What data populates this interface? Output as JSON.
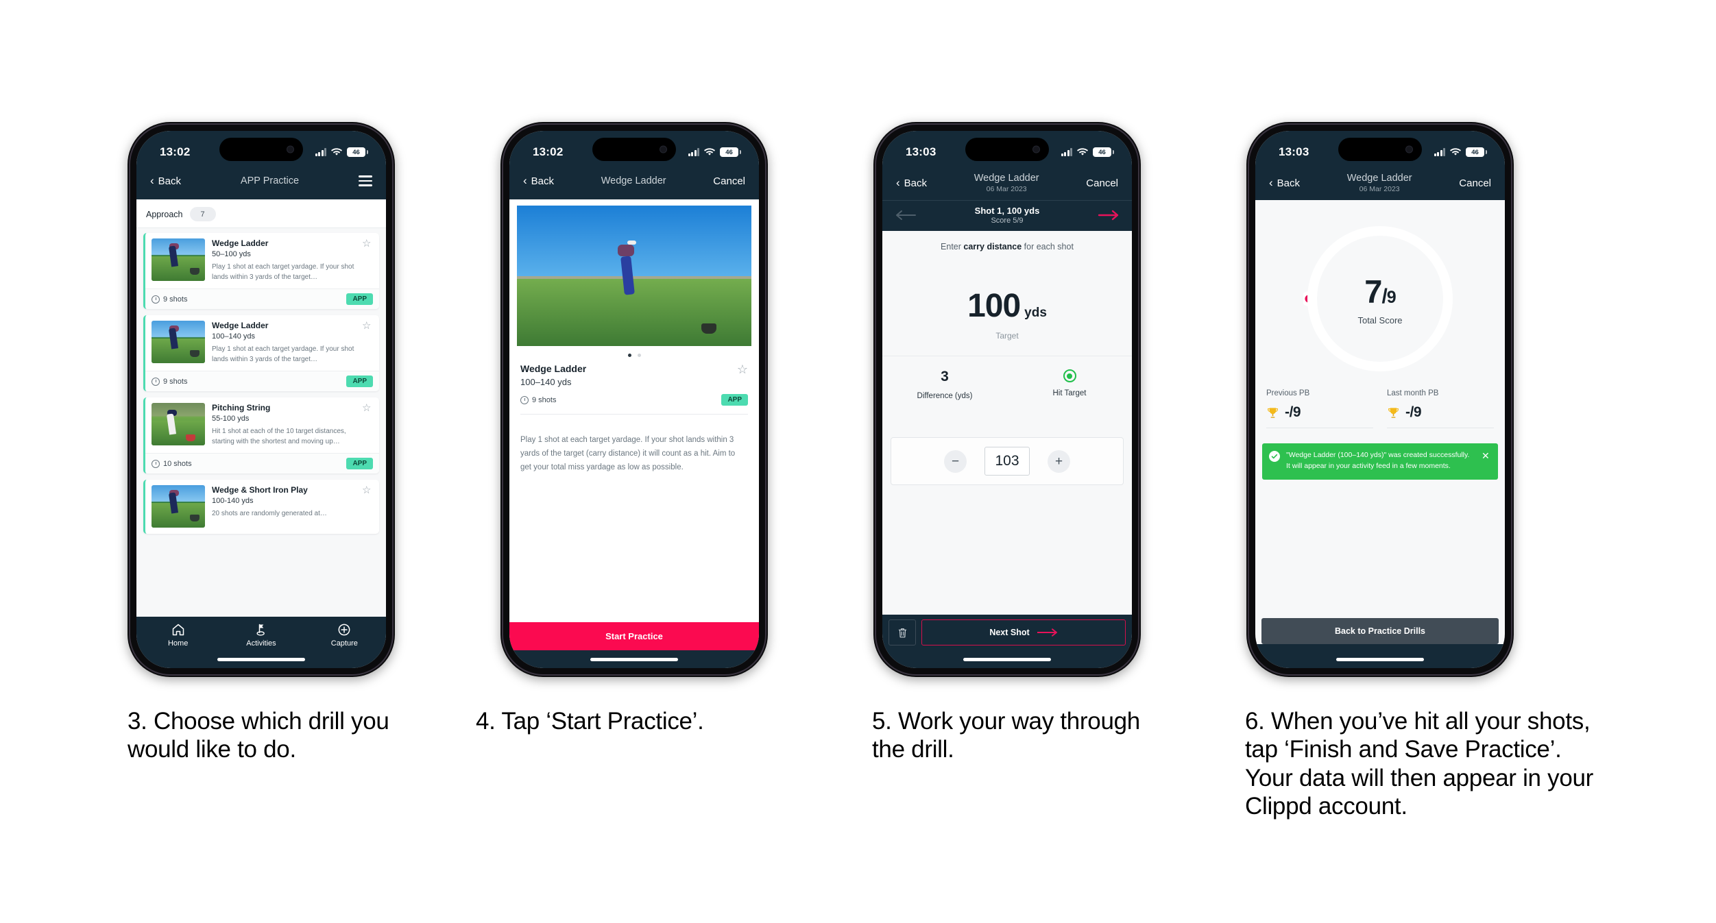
{
  "screens": [
    {
      "status": {
        "time": "13:02",
        "battery": "46"
      },
      "nav": {
        "back": "Back",
        "title": "APP Practice",
        "menu_icon": "hamburger-icon"
      },
      "section": {
        "name": "Approach",
        "count": "7"
      },
      "cards": [
        {
          "title": "Wedge Ladder",
          "yards": "50–100 yds",
          "desc": "Play 1 shot at each target yardage. If your shot lands within 3 yards of the target…",
          "shots": "9 shots",
          "badge": "APP"
        },
        {
          "title": "Wedge Ladder",
          "yards": "100–140 yds",
          "desc": "Play 1 shot at each target yardage. If your shot lands within 3 yards of the target…",
          "shots": "9 shots",
          "badge": "APP"
        },
        {
          "title": "Pitching String",
          "yards": "55-100 yds",
          "desc": "Hit 1 shot at each of the 10 target distances, starting with the shortest and moving up…",
          "shots": "10 shots",
          "badge": "APP"
        },
        {
          "title": "Wedge & Short Iron Play",
          "yards": "100-140 yds",
          "desc": "20 shots are randomly generated at…",
          "shots": "",
          "badge": ""
        }
      ],
      "tabs": [
        {
          "label": "Home",
          "icon": "home-icon"
        },
        {
          "label": "Activities",
          "icon": "golf-flag-icon"
        },
        {
          "label": "Capture",
          "icon": "plus-circle-icon"
        }
      ]
    },
    {
      "status": {
        "time": "13:02",
        "battery": "46"
      },
      "nav": {
        "back": "Back",
        "title": "Wedge Ladder",
        "right": "Cancel"
      },
      "detail": {
        "title": "Wedge Ladder",
        "yards": "100–140 yds",
        "shots": "9 shots",
        "badge": "APP",
        "desc": "Play 1 shot at each target yardage. If your shot lands within 3 yards of the target (carry distance) it will count as a hit. Aim to get your total miss yardage as low as possible."
      },
      "cta": "Start Practice"
    },
    {
      "status": {
        "time": "13:03",
        "battery": "46"
      },
      "nav": {
        "back": "Back",
        "title": "Wedge Ladder",
        "subtitle": "06 Mar 2023",
        "right": "Cancel"
      },
      "subnav": {
        "shot": "Shot 1, 100 yds",
        "score": "Score 5/9"
      },
      "prompt_pre": "Enter ",
      "prompt_bold": "carry distance",
      "prompt_post": " for each shot",
      "target": {
        "value": "100",
        "unit": "yds",
        "label": "Target"
      },
      "stats": [
        {
          "value": "3",
          "label": "Difference (yds)"
        },
        {
          "value": "",
          "label": "Hit Target",
          "icon": "hit-target-icon"
        }
      ],
      "stepper": {
        "minus": "−",
        "value": "103",
        "plus": "+"
      },
      "footer": {
        "delete_icon": "trash-icon",
        "next": "Next Shot"
      }
    },
    {
      "status": {
        "time": "13:03",
        "battery": "46"
      },
      "nav": {
        "back": "Back",
        "title": "Wedge Ladder",
        "subtitle": "06 Mar 2023",
        "right": "Cancel"
      },
      "result": {
        "score": "7",
        "slash": "/",
        "denominator": "9",
        "label": "Total Score",
        "progress_percent": 78
      },
      "pbs": [
        {
          "label": "Previous PB",
          "value": "-/9",
          "icon": "trophy-icon"
        },
        {
          "label": "Last month PB",
          "value": "-/9",
          "icon": "trophy-icon"
        }
      ],
      "toast": {
        "message": "\"Wedge Ladder (100–140 yds)\" was created successfully. It will appear in your activity feed in a few moments.",
        "close_icon": "close-icon",
        "check_icon": "check-icon",
        "color": "#2ec04f"
      },
      "back_button": "Back to Practice Drills"
    }
  ],
  "captions": [
    "3. Choose which drill you would like to do.",
    "4. Tap ‘Start Practice’.",
    "5. Work your way through the drill.",
    "6. When you’ve hit all your shots, tap ‘Finish and Save Practice’. Your data will then appear in your Clippd account."
  ],
  "colors": {
    "nav_dark": "#152a38",
    "accent_pink": "#fb0a50",
    "accent_teal": "#4ddbb0",
    "success_green": "#2ec04f",
    "page_bg": "#ffffff"
  }
}
